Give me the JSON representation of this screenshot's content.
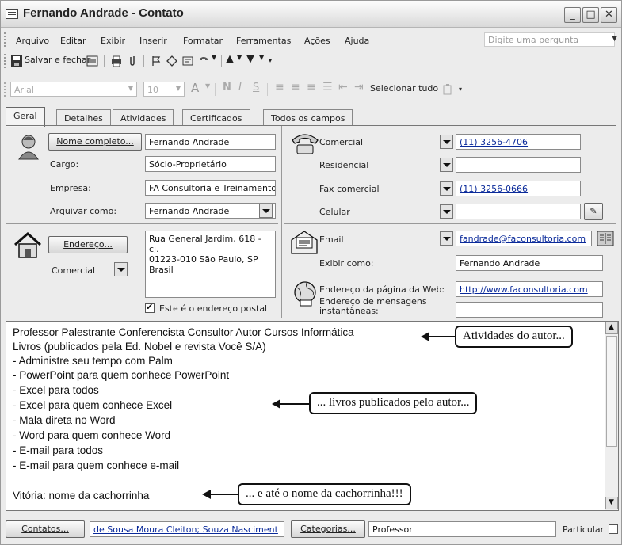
{
  "window": {
    "title": "Fernando Andrade - Contato"
  },
  "menu": [
    "Arquivo",
    "Editar",
    "Exibir",
    "Inserir",
    "Formatar",
    "Ferramentas",
    "Ações",
    "Ajuda"
  ],
  "ask_placeholder": "Digite uma pergunta",
  "toolbar": {
    "save_close": "Salvar e fechar"
  },
  "format_toolbar": {
    "font": "Arial",
    "size": "10",
    "select_all": "Selecionar tudo"
  },
  "tabs": [
    "Geral",
    "Detalhes",
    "Atividades",
    "Certificados",
    "Todos os campos"
  ],
  "general": {
    "full_name_button": "Nome completo...",
    "full_name": "Fernando Andrade",
    "job_title_label": "Cargo:",
    "job_title": "Sócio-Proprietário",
    "company_label": "Empresa:",
    "company": "FA Consultoria e Treinamento",
    "file_as_label": "Arquivar como:",
    "file_as": "Fernando Andrade",
    "address_button": "Endereço...",
    "address_type": "Comercial",
    "address_lines": [
      "Rua General Jardim, 618 - cj.",
      "01223-010  São Paulo, SP",
      "Brasil"
    ],
    "mailing_address_label": "Este é o endereço postal"
  },
  "phones": [
    {
      "label": "Comercial",
      "value": "(11) 3256-4706"
    },
    {
      "label": "Residencial",
      "value": ""
    },
    {
      "label": "Fax comercial",
      "value": "(11) 3256-0666"
    },
    {
      "label": "Celular",
      "value": ""
    }
  ],
  "email": {
    "label": "Email",
    "value": "fandrade@faconsultoria.com",
    "display_label": "Exibir como:",
    "display_value": "Fernando Andrade"
  },
  "web": {
    "label": "Endereço da página da Web:",
    "value": "http://www.faconsultoria.com",
    "im_label_1": "Endereço de mensagens",
    "im_label_2": "instantâneas:",
    "im_value": ""
  },
  "notes": [
    "Professor Palestrante Conferencista Consultor Autor Cursos Informática",
    "Livros (publicados pela Ed. Nobel e revista Você S/A)",
    "- Administre seu tempo com Palm",
    "- PowerPoint para quem conhece PowerPoint",
    "- Excel para todos",
    "- Excel para quem conhece Excel",
    "- Mala direta no Word",
    "- Word para quem conhece Word",
    "- E-mail para todos",
    "- E-mail para quem conhece e-mail",
    "",
    "Vitória: nome da cachorrinha"
  ],
  "callouts": {
    "activities": "Atividades do autor...",
    "books": "... livros publicados pelo autor...",
    "dog": "... e até o nome da cachorrinha!!!"
  },
  "footer": {
    "contacts_button": "Contatos...",
    "contacts_value": "de Sousa Moura Cleiton; Souza Nasciment",
    "categories_button": "Categorias...",
    "categories_value": "Professor",
    "private_label": "Particular"
  }
}
